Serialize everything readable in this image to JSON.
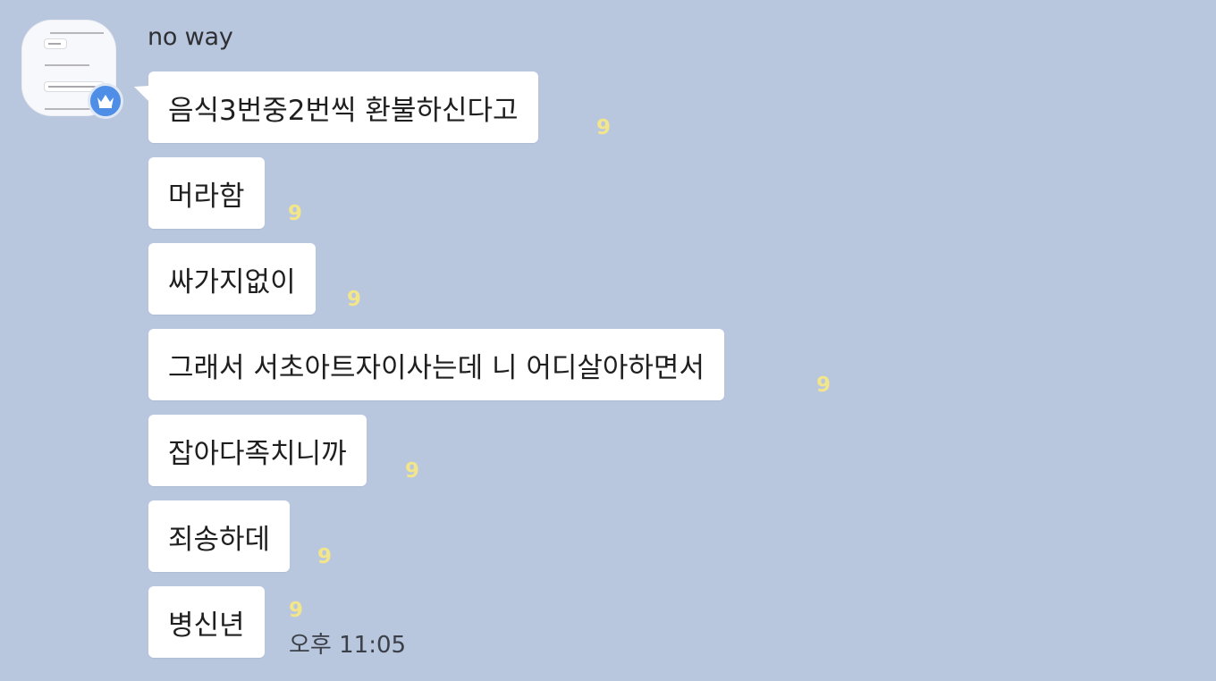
{
  "sender": {
    "name": "no way",
    "badge_icon": "crown-icon"
  },
  "messages": [
    {
      "text": "음식3번중2번씩 환불하신다고",
      "unread": "9"
    },
    {
      "text": "머라함",
      "unread": "9"
    },
    {
      "text": "싸가지없이",
      "unread": "9"
    },
    {
      "text": "그래서 서초아트자이사는데 니 어디살아하면서",
      "unread": "9"
    },
    {
      "text": "잡아다족치니까",
      "unread": "9"
    },
    {
      "text": "죄송하데",
      "unread": "9"
    },
    {
      "text": "병신년",
      "unread": "9"
    }
  ],
  "last_timestamp": "오후 11:05",
  "colors": {
    "background": "#b8c6de",
    "bubble": "#ffffff",
    "unread_count": "#f2e58a",
    "badge": "#4f8ee6"
  }
}
